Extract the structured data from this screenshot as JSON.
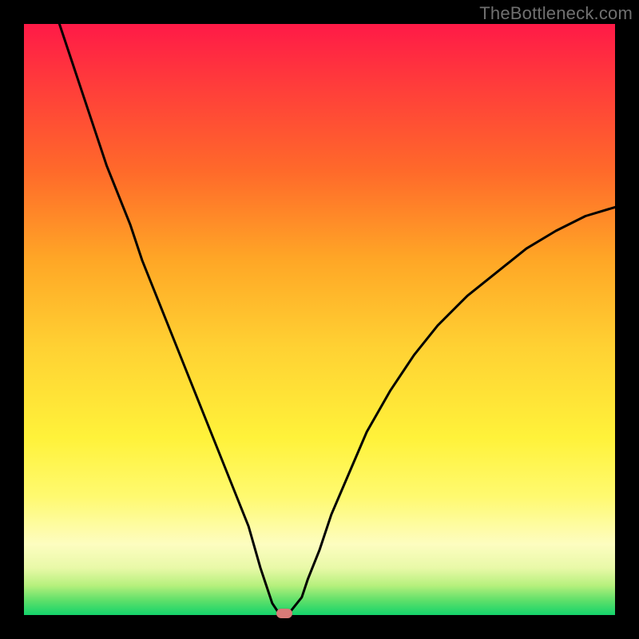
{
  "watermark": "TheBottleneck.com",
  "chart_data": {
    "type": "line",
    "title": "",
    "xlabel": "",
    "ylabel": "",
    "xlim": [
      0,
      100
    ],
    "ylim": [
      0,
      100
    ],
    "grid": false,
    "legend": false,
    "annotations": [],
    "series": [
      {
        "name": "bottleneck-curve",
        "x": [
          6,
          8,
          10,
          12,
          14,
          16,
          18,
          20,
          22,
          24,
          26,
          28,
          30,
          32,
          34,
          36,
          38,
          40,
          41,
          42,
          43,
          44,
          45,
          47,
          48,
          50,
          52,
          55,
          58,
          62,
          66,
          70,
          75,
          80,
          85,
          90,
          95,
          100
        ],
        "y": [
          100,
          94,
          88,
          82,
          76,
          71,
          66,
          60,
          55,
          50,
          45,
          40,
          35,
          30,
          25,
          20,
          15,
          8,
          5,
          2,
          0.5,
          0,
          0.5,
          3,
          6,
          11,
          17,
          24,
          31,
          38,
          44,
          49,
          54,
          58,
          62,
          65,
          67.5,
          69
        ]
      }
    ],
    "marker": {
      "x": 44,
      "y": 0,
      "color": "#d77a77"
    },
    "background_gradient": {
      "top": "#ff1a47",
      "bottom": "#14d36b",
      "stops": [
        "red",
        "orange",
        "yellow",
        "green"
      ]
    }
  },
  "colors": {
    "curve": "#000000",
    "frame_bg": "#000000",
    "marker": "#d77a77",
    "watermark": "#707070"
  }
}
